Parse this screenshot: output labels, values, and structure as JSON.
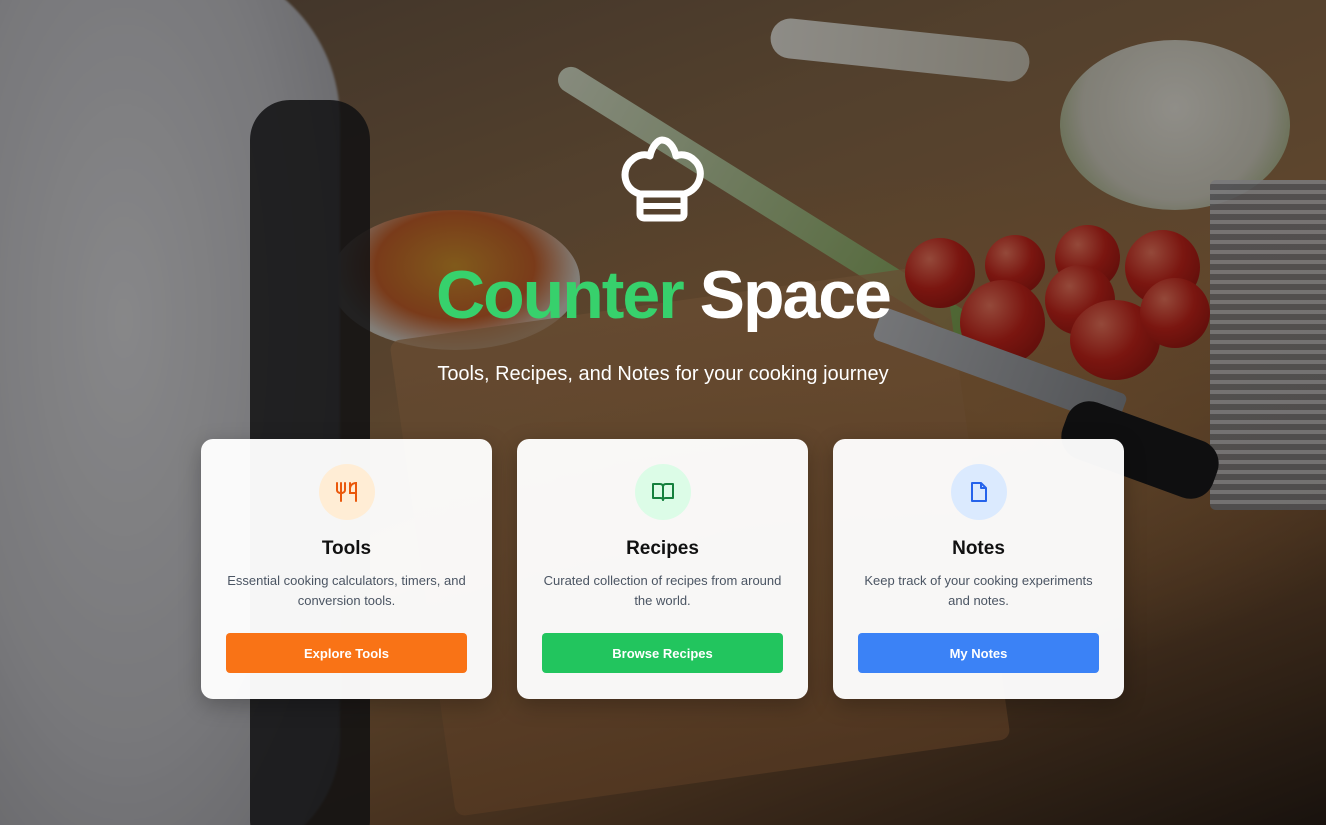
{
  "hero": {
    "title_part1": "Counter",
    "title_part2": "Space",
    "subtitle": "Tools, Recipes, and Notes for your cooking journey",
    "logo_icon": "chef-hat-icon"
  },
  "colors": {
    "brand_green": "#37d16c",
    "tools_orange": "#f97316",
    "recipes_green": "#22c55e",
    "notes_blue": "#3b82f6"
  },
  "cards": [
    {
      "icon": "utensils-icon",
      "title": "Tools",
      "description": "Essential cooking calculators, timers, and conversion tools.",
      "button_label": "Explore Tools"
    },
    {
      "icon": "open-book-icon",
      "title": "Recipes",
      "description": "Curated collection of recipes from around the world.",
      "button_label": "Browse Recipes"
    },
    {
      "icon": "note-icon",
      "title": "Notes",
      "description": "Keep track of your cooking experiments and notes.",
      "button_label": "My Notes"
    }
  ]
}
